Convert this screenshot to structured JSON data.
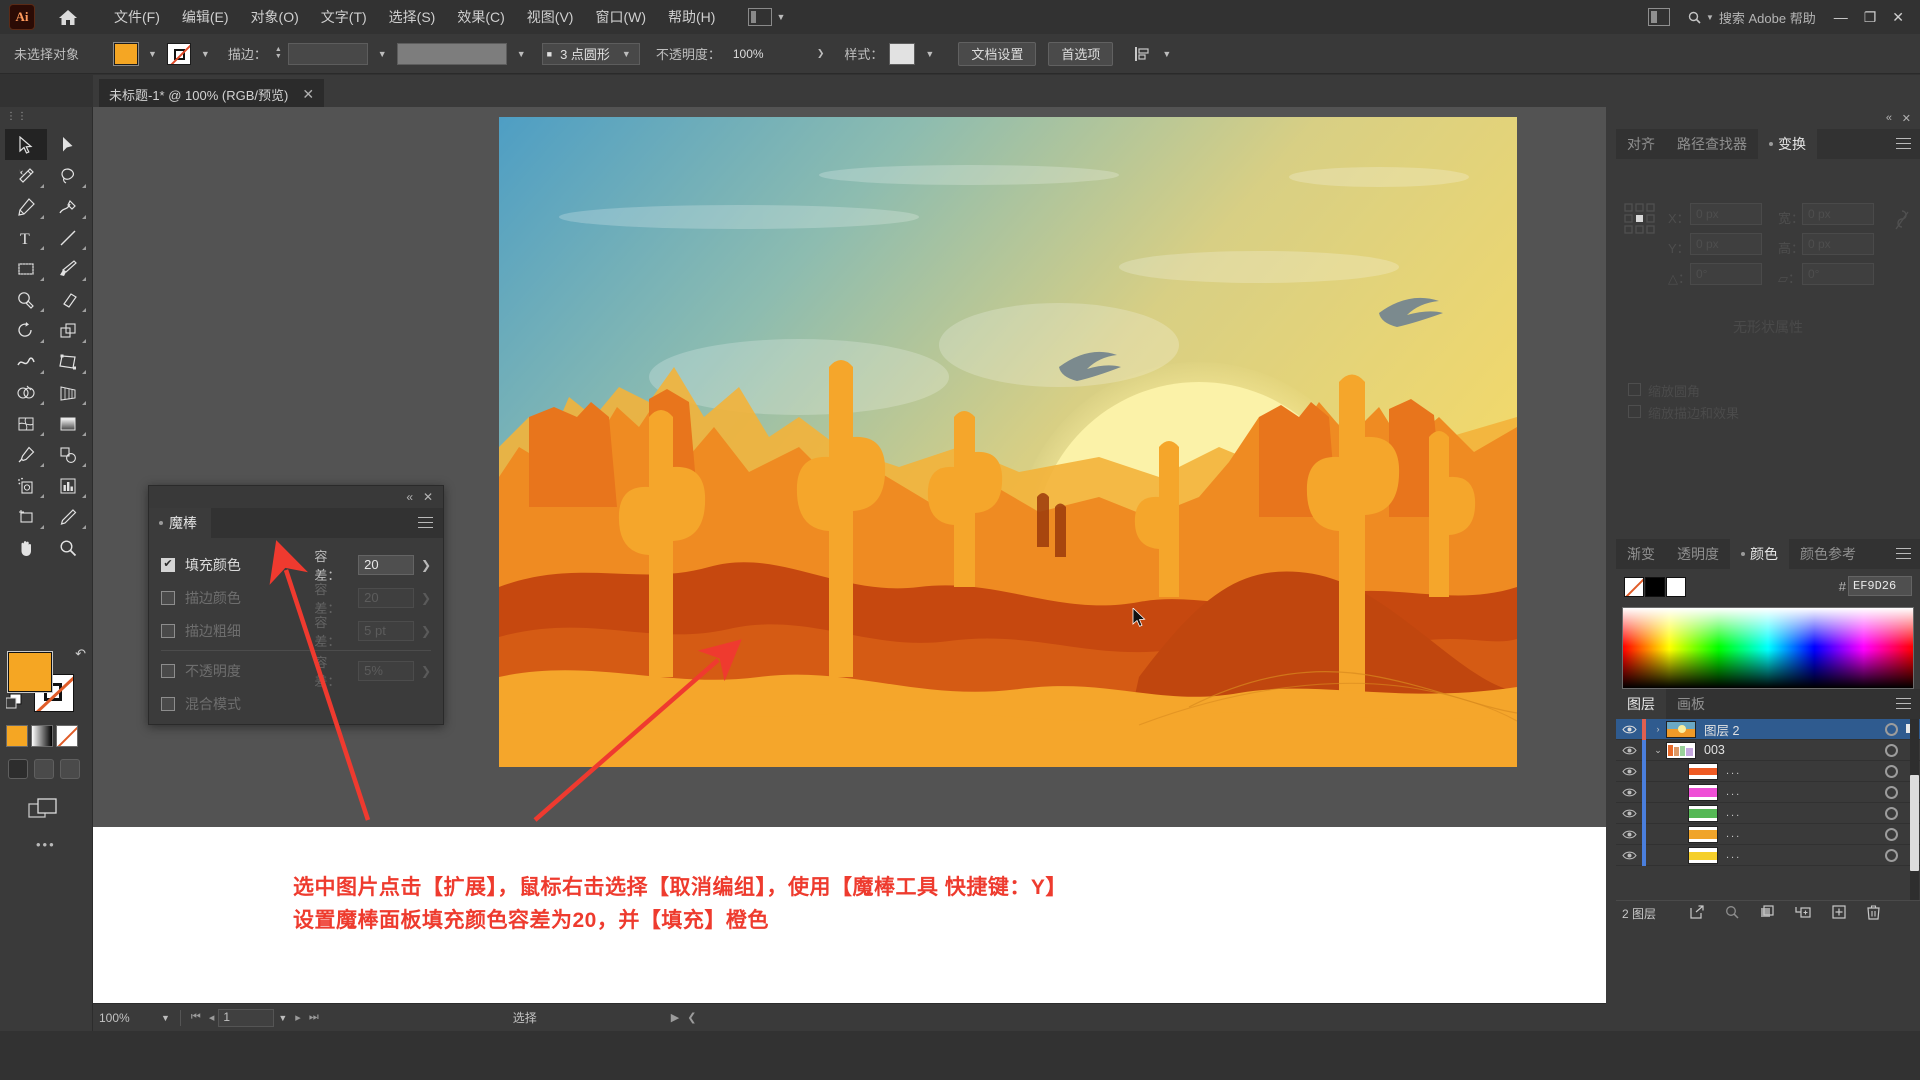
{
  "app": {
    "logo": "Ai",
    "home_icon": "home-icon"
  },
  "menubar": {
    "items": [
      {
        "label": "文件(F)"
      },
      {
        "label": "编辑(E)"
      },
      {
        "label": "对象(O)"
      },
      {
        "label": "文字(T)"
      },
      {
        "label": "选择(S)"
      },
      {
        "label": "效果(C)"
      },
      {
        "label": "视图(V)"
      },
      {
        "label": "窗口(W)"
      },
      {
        "label": "帮助(H)"
      }
    ],
    "search_placeholder": "搜索 Adobe 帮助",
    "workspace_icon": "workspace-switcher-icon",
    "minimize": "—",
    "restore": "❐",
    "close": "✕"
  },
  "controlbar": {
    "selection_status": "未选择对象",
    "fill_color": "#f5a623",
    "stroke_label": "描边：",
    "stroke_weight": "",
    "brush_definition": "",
    "profile_label": "3 点圆形",
    "opacity_label": "不透明度：",
    "opacity_value": "100%",
    "style_label": "样式：",
    "doc_setup_button": "文档设置",
    "preferences_button": "首选项",
    "align_icon": "align-icon"
  },
  "document_tab": {
    "title": "未标题-1* @ 100% (RGB/预览)",
    "close": "✕"
  },
  "toolbar": {
    "tools": [
      {
        "name": "selection-tool",
        "selected": true
      },
      {
        "name": "direct-selection-tool",
        "selected": false
      },
      {
        "name": "magic-wand-tool",
        "selected": false
      },
      {
        "name": "lasso-tool",
        "selected": false
      },
      {
        "name": "pen-tool",
        "selected": false
      },
      {
        "name": "curvature-tool",
        "selected": false
      },
      {
        "name": "type-tool",
        "selected": false
      },
      {
        "name": "line-segment-tool",
        "selected": false
      },
      {
        "name": "rectangle-tool",
        "selected": false
      },
      {
        "name": "paintbrush-tool",
        "selected": false
      },
      {
        "name": "shaper-tool",
        "selected": false
      },
      {
        "name": "eraser-tool",
        "selected": false
      },
      {
        "name": "rotate-tool",
        "selected": false
      },
      {
        "name": "scale-tool",
        "selected": false
      },
      {
        "name": "width-tool",
        "selected": false
      },
      {
        "name": "free-transform-tool",
        "selected": false
      },
      {
        "name": "shape-builder-tool",
        "selected": false
      },
      {
        "name": "perspective-grid-tool",
        "selected": false
      },
      {
        "name": "mesh-tool",
        "selected": false
      },
      {
        "name": "gradient-tool",
        "selected": false
      },
      {
        "name": "eyedropper-tool",
        "selected": false
      },
      {
        "name": "blend-tool",
        "selected": false
      },
      {
        "name": "symbol-sprayer-tool",
        "selected": false
      },
      {
        "name": "column-graph-tool",
        "selected": false
      },
      {
        "name": "artboard-tool",
        "selected": false
      },
      {
        "name": "slice-tool",
        "selected": false
      },
      {
        "name": "hand-tool",
        "selected": false
      },
      {
        "name": "zoom-tool",
        "selected": false
      }
    ],
    "fill_color": "#f5a623",
    "stroke_color": "#ffffff",
    "more_tools": "•••"
  },
  "magic_wand_panel": {
    "tab_label": "魔棒",
    "close": "✕",
    "collapse": "«",
    "rows": [
      {
        "label": "填充颜色",
        "checked": true,
        "tolerance_label": "容差：",
        "tolerance_value": "20",
        "enabled": true
      },
      {
        "label": "描边颜色",
        "checked": false,
        "tolerance_label": "容差：",
        "tolerance_value": "20",
        "enabled": false
      },
      {
        "label": "描边粗细",
        "checked": false,
        "tolerance_label": "容差：",
        "tolerance_value": "5 pt",
        "enabled": false
      },
      {
        "label": "不透明度",
        "checked": false,
        "tolerance_label": "容差：",
        "tolerance_value": "5%",
        "enabled": false
      },
      {
        "label": "混合模式",
        "checked": false,
        "tolerance_label": "",
        "tolerance_value": "",
        "enabled": false
      }
    ]
  },
  "right_panels": {
    "transform": {
      "tabs": [
        {
          "label": "对齐",
          "active": false
        },
        {
          "label": "路径查找器",
          "active": false
        },
        {
          "label": "变换",
          "active": true
        }
      ],
      "x_label": "X：",
      "x_value": "0 px",
      "y_label": "Y：",
      "y_value": "0 px",
      "w_label": "宽：",
      "w_value": "0 px",
      "h_label": "高：",
      "h_value": "0 px",
      "angle_label": "△：",
      "angle_value": "0°",
      "shear_label": "▱：",
      "shear_value": "0°",
      "no_selection_text": "无形状属性",
      "scale_corners_label": "缩放圆角",
      "scale_strokes_label": "缩放描边和效果",
      "link_icon": "link-dimensions-icon"
    },
    "color": {
      "tabs": [
        {
          "label": "渐变",
          "active": false
        },
        {
          "label": "透明度",
          "active": false
        },
        {
          "label": "颜色",
          "active": true
        },
        {
          "label": "颜色参考",
          "active": false
        }
      ],
      "hash": "#",
      "hex_value": "EF9D26",
      "none_swatch": "none-swatch-icon",
      "black_swatch": "#000000",
      "white_swatch": "#ffffff"
    },
    "layers": {
      "tabs": [
        {
          "label": "图层",
          "active": true
        },
        {
          "label": "画板",
          "active": false
        }
      ],
      "rows": [
        {
          "name": "图层 2",
          "indent": 0,
          "selected": true,
          "twisty": "›",
          "bar_color": "#e06050",
          "thumb": "sunset-thumb",
          "eye": true
        },
        {
          "name": "003",
          "indent": 0,
          "selected": false,
          "twisty": "⌄",
          "bar_color": "#4a7fdd",
          "thumb": "group-thumb",
          "eye": true
        },
        {
          "name": "...",
          "indent": 1,
          "selected": false,
          "twisty": "",
          "bar_color": "#4a7fdd",
          "thumb": "path-orange",
          "eye": true
        },
        {
          "name": "...",
          "indent": 1,
          "selected": false,
          "twisty": "",
          "bar_color": "#4a7fdd",
          "thumb": "path-magenta",
          "eye": true
        },
        {
          "name": "...",
          "indent": 1,
          "selected": false,
          "twisty": "",
          "bar_color": "#4a7fdd",
          "thumb": "path-green",
          "eye": true
        },
        {
          "name": "...",
          "indent": 1,
          "selected": false,
          "twisty": "",
          "bar_color": "#4a7fdd",
          "thumb": "path-amber",
          "eye": true
        },
        {
          "name": "...",
          "indent": 1,
          "selected": false,
          "twisty": "",
          "bar_color": "#4a7fdd",
          "thumb": "path-yellow",
          "eye": true
        }
      ],
      "footer_count": "2 图层",
      "footer_icons": [
        "locate-object-icon",
        "search-icon",
        "make-clipping-mask-icon",
        "create-sublayer-icon",
        "create-new-layer-icon",
        "delete-selection-icon"
      ]
    }
  },
  "annotation": {
    "line1": "选中图片点击【扩展】，鼠标右击选择【取消编组】，使用【魔棒工具 快捷键：Y】",
    "line2": "设置魔棒面板填充颜色容差为20，并【填充】橙色",
    "color": "#ee3b2e"
  },
  "statusbar": {
    "zoom": "100%",
    "artboard_number": "1",
    "status_text": "选择",
    "first_icon": "⏮",
    "prev_icon": "◂",
    "next_icon": "▸",
    "last_icon": "⏭"
  },
  "artwork": {
    "description": "desert-sunset-illustration",
    "sky_top": "#5aa8c8",
    "sky_mid": "#a8c8a0",
    "sky_warm": "#f0d26a",
    "sun": "#fbee9e",
    "sand": "#f5a62b",
    "mesa_dark": "#c24a16",
    "mesa_mid": "#e8701f",
    "cactus": "#f5a62b"
  }
}
